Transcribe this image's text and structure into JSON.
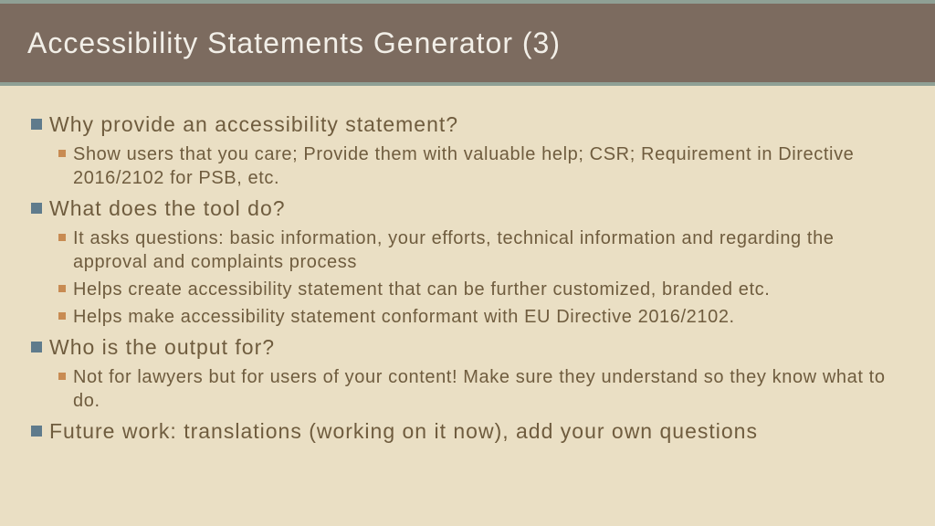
{
  "colors": {
    "slide_bg": "#eadfc4",
    "header_bg": "#7c6b5f",
    "header_border": "#8fa095",
    "title_color": "#f2efe8",
    "text_color": "#6f5c3e",
    "bullet1_color": "#5f7b8c",
    "bullet2_color": "#c88b52"
  },
  "header": {
    "title": "Accessibility Statements Generator (3)"
  },
  "content": [
    {
      "text": "Why provide an accessibility statement?",
      "children": [
        "Show users that you care; Provide them with valuable help; CSR; Requirement in Directive 2016/2102 for PSB, etc."
      ]
    },
    {
      "text": "What does the tool do?",
      "children": [
        "It asks questions: basic information, your efforts, technical information and regarding the approval and complaints process",
        "Helps create accessibility statement that can be further customized, branded etc.",
        "Helps make accessibility statement conformant with EU Directive 2016/2102."
      ]
    },
    {
      "text": "Who is the output for?",
      "children": [
        "Not for lawyers but for users of your content! Make sure they understand so they know what to do."
      ]
    },
    {
      "text": "Future work: translations (working on it now), add your own questions",
      "children": []
    }
  ]
}
